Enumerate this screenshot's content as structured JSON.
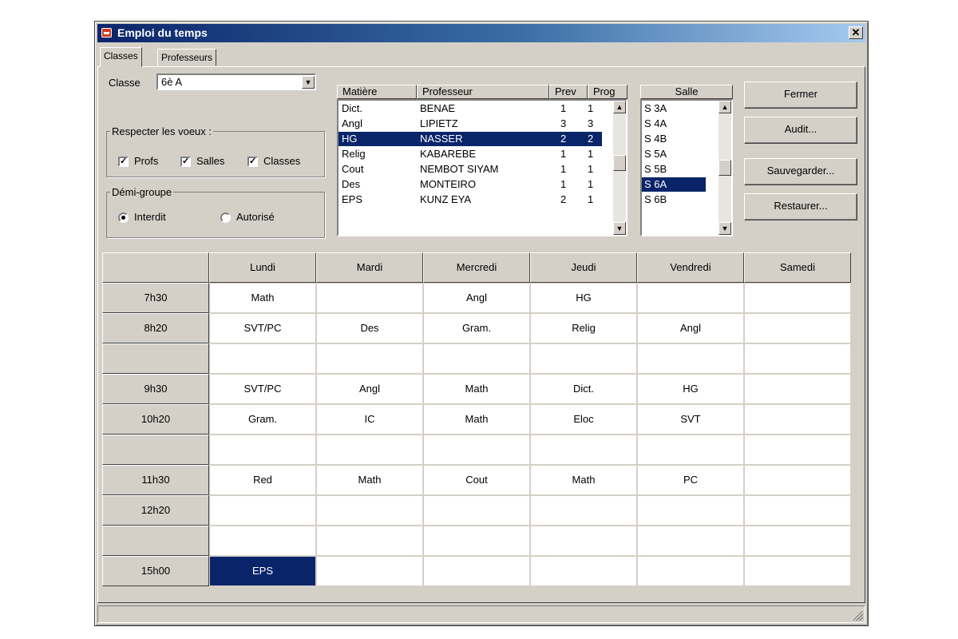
{
  "window": {
    "title": "Emploi du temps"
  },
  "tabs": [
    {
      "label": "Classes",
      "active": true
    },
    {
      "label": "Professeurs",
      "active": false
    }
  ],
  "classe": {
    "label": "Classe",
    "value": "6è A"
  },
  "voeux": {
    "title": "Respecter les voeux :",
    "options": [
      {
        "label": "Profs",
        "checked": true
      },
      {
        "label": "Salles",
        "checked": true
      },
      {
        "label": "Classes",
        "checked": true
      }
    ]
  },
  "demi_groupe": {
    "title": "Démi-groupe",
    "options": [
      {
        "label": "Interdit",
        "selected": true
      },
      {
        "label": "Autorisé",
        "selected": false
      }
    ]
  },
  "subjects": {
    "columns": {
      "matiere": "Matière",
      "professeur": "Professeur",
      "prev": "Prev",
      "prog": "Prog"
    },
    "rows": [
      {
        "matiere": "Dict.",
        "professeur": "BENAE",
        "prev": "1",
        "prog": "1"
      },
      {
        "matiere": "Angl",
        "professeur": "LIPIETZ",
        "prev": "3",
        "prog": "3"
      },
      {
        "matiere": "HG",
        "professeur": "NASSER",
        "prev": "2",
        "prog": "2",
        "selected": true
      },
      {
        "matiere": "Relig",
        "professeur": "KABAREBE",
        "prev": "1",
        "prog": "1"
      },
      {
        "matiere": "Cout",
        "professeur": "NEMBOT SIYAM",
        "prev": "1",
        "prog": "1"
      },
      {
        "matiere": "Des",
        "professeur": "MONTEIRO",
        "prev": "1",
        "prog": "1"
      },
      {
        "matiere": "EPS",
        "professeur": "KUNZ EYA",
        "prev": "2",
        "prog": "1"
      }
    ]
  },
  "rooms": {
    "header": "Salle",
    "items": [
      {
        "label": "S 3A"
      },
      {
        "label": "S 4A"
      },
      {
        "label": "S 4B"
      },
      {
        "label": "S 5A"
      },
      {
        "label": "S 5B"
      },
      {
        "label": "S 6A",
        "selected": true
      },
      {
        "label": "S 6B"
      }
    ]
  },
  "buttons": {
    "fermer": "Fermer",
    "audit": "Audit...",
    "sauvegarder": "Sauvegarder...",
    "restaurer": "Restaurer..."
  },
  "timetable": {
    "days": [
      "Lundi",
      "Mardi",
      "Mercredi",
      "Jeudi",
      "Vendredi",
      "Samedi"
    ],
    "rows": [
      {
        "time": "7h30",
        "cells": [
          "Math",
          "",
          "Angl",
          "HG",
          "",
          ""
        ]
      },
      {
        "time": "8h20",
        "cells": [
          "SVT/PC",
          "Des",
          "Gram.",
          "Relig",
          "Angl",
          ""
        ]
      },
      {
        "time": "",
        "cells": [
          "",
          "",
          "",
          "",
          "",
          ""
        ]
      },
      {
        "time": "9h30",
        "cells": [
          "SVT/PC",
          "Angl",
          "Math",
          "Dict.",
          "HG",
          ""
        ]
      },
      {
        "time": "10h20",
        "cells": [
          "Gram.",
          "IC",
          "Math",
          "Eloc",
          "SVT",
          ""
        ]
      },
      {
        "time": "",
        "cells": [
          "",
          "",
          "",
          "",
          "",
          ""
        ]
      },
      {
        "time": "11h30",
        "cells": [
          "Red",
          "Math",
          "Cout",
          "Math",
          "PC",
          ""
        ]
      },
      {
        "time": "12h20",
        "cells": [
          "",
          "",
          "",
          "",
          "",
          ""
        ]
      },
      {
        "time": "",
        "cells": [
          "",
          "",
          "",
          "",
          "",
          ""
        ]
      },
      {
        "time": "15h00",
        "cells": [
          "EPS",
          "",
          "",
          "",
          "",
          ""
        ]
      }
    ],
    "selected_cell": {
      "row": 9,
      "col": 0
    }
  },
  "colors": {
    "selection": "#0a246a",
    "face": "#d4d0c8"
  },
  "icons": [
    "app-icon",
    "close-icon",
    "dropdown-arrow-icon",
    "scroll-up-arrow-icon",
    "scroll-down-arrow-icon",
    "resize-grip-icon"
  ]
}
